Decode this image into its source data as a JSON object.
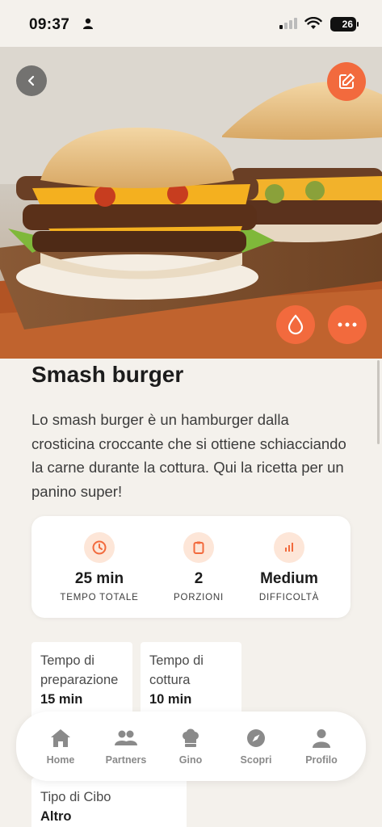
{
  "status": {
    "time": "09:37",
    "battery": "26"
  },
  "recipe": {
    "title": "Smash burger",
    "description": "Lo smash burger è un hamburger dalla crosticina croccante che si ottiene schiacciando la carne durante la cottura. Qui la ricetta per un panino super!"
  },
  "stats": [
    {
      "icon": "clock-icon",
      "value": "25 min",
      "label": "TEMPO TOTALE"
    },
    {
      "icon": "clipboard-icon",
      "value": "2",
      "label": "PORZIONI"
    },
    {
      "icon": "bar-chart-icon",
      "value": "Medium",
      "label": "DIFFICOLTÀ"
    }
  ],
  "details": [
    {
      "label": "Tempo di preparazione",
      "value": "15 min"
    },
    {
      "label": "Tempo di cottura",
      "value": "10 min"
    },
    {
      "label": "Tipo di Cibo",
      "value": "Altro"
    }
  ],
  "tabs": [
    {
      "icon": "home-icon",
      "label": "Home"
    },
    {
      "icon": "partners-icon",
      "label": "Partners"
    },
    {
      "icon": "chef-hat-icon",
      "label": "Gino"
    },
    {
      "icon": "compass-icon",
      "label": "Scopri"
    },
    {
      "icon": "profile-icon",
      "label": "Profilo"
    }
  ],
  "colors": {
    "accent": "#f26a3d",
    "accent_light": "#fde6d8",
    "background": "#f4f1ec"
  }
}
